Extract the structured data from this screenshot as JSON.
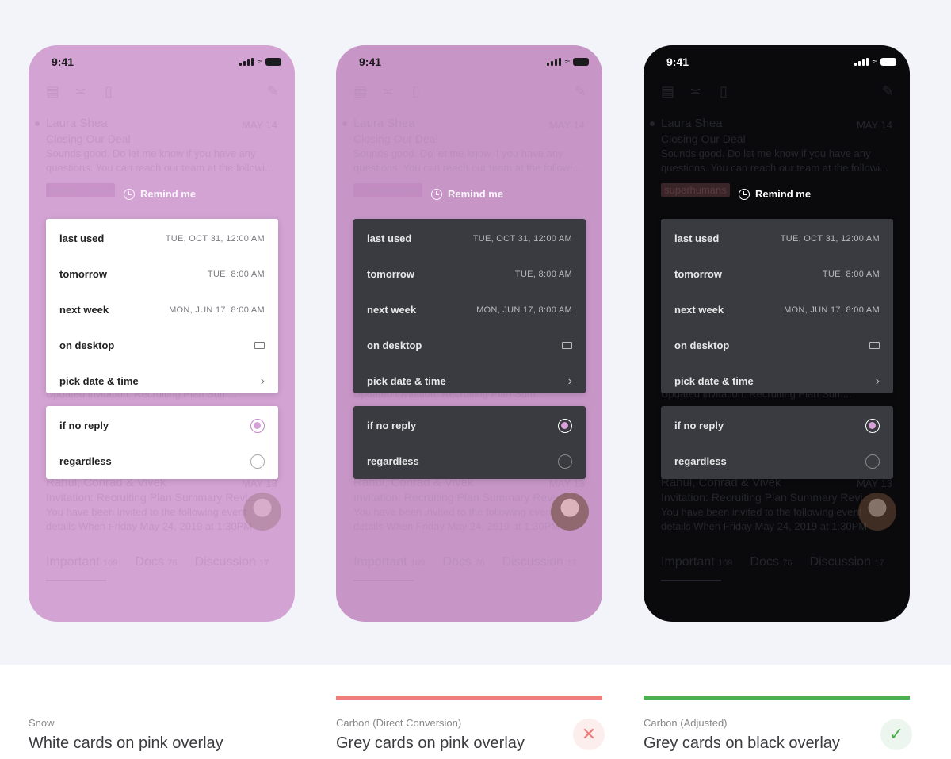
{
  "status": {
    "time": "9:41"
  },
  "list": {
    "row1": {
      "name": "Laura Shea",
      "date": "MAY 14",
      "subject": "Closing Our Deal",
      "snippet1": "Sounds good. Do let me know if you have any",
      "snippet2": "questions. You can reach our team at the followi...",
      "tag": "superhumans"
    },
    "row2": {
      "subject": "Updated invitation: Recruiting Plan Sum..."
    },
    "row3": {
      "name": "Rahul, Conrad & Vivek",
      "date": "MAY 13",
      "subject": "Invitation: Recruiting Plan Summary Revi...",
      "snippet1": "You have been invited to the following event",
      "snippet2": "details When Friday May 24, 2019 at 1:30PM"
    }
  },
  "remind": {
    "label": "Remind me"
  },
  "menu": [
    {
      "label": "last used",
      "value": "TUE, OCT 31, 12:00 AM"
    },
    {
      "label": "tomorrow",
      "value": "TUE, 8:00 AM"
    },
    {
      "label": "next week",
      "value": "MON, JUN 17, 8:00 AM"
    },
    {
      "label": "on desktop",
      "icon": "laptop-icon"
    },
    {
      "label": "pick date & time",
      "icon": "chevron-right-icon"
    }
  ],
  "options": [
    {
      "label": "if no reply",
      "selected": true
    },
    {
      "label": "regardless",
      "selected": false
    }
  ],
  "tabs": [
    {
      "label": "Important",
      "count": "109"
    },
    {
      "label": "Docs",
      "count": "76"
    },
    {
      "label": "Discussion",
      "count": "17"
    }
  ],
  "captions": [
    {
      "subtitle": "Snow",
      "title": "White cards on pink overlay"
    },
    {
      "subtitle": "Carbon (Direct Conversion)",
      "title": "Grey cards on pink overlay",
      "status": "fail",
      "color": "#f07c7c"
    },
    {
      "subtitle": "Carbon (Adjusted)",
      "title": "Grey cards on black overlay",
      "status": "pass",
      "color": "#4caf50"
    }
  ],
  "colors": {
    "accent": "#d79fd8",
    "pink_overlay": "#d3a3d3",
    "black_overlay": "#0a0a0d",
    "card_dark": "#3a3b40"
  }
}
